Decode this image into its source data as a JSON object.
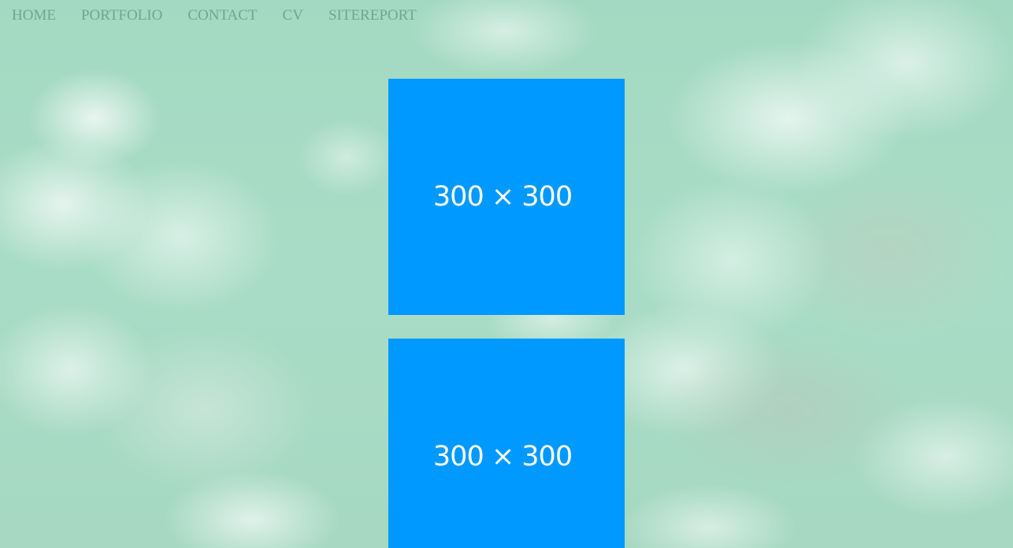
{
  "nav": {
    "items": [
      {
        "label": "HOME"
      },
      {
        "label": "PORTFOLIO"
      },
      {
        "label": "CONTACT"
      },
      {
        "label": "CV"
      },
      {
        "label": "SITEREPORT"
      }
    ]
  },
  "gallery": {
    "tiles": [
      {
        "label": "300 × 300"
      },
      {
        "label": "300 × 300"
      }
    ]
  },
  "colors": {
    "background": "#a7dac4",
    "nav_text": "#6fa693",
    "tile": "#0099ff",
    "tile_text": "#ffffff"
  }
}
